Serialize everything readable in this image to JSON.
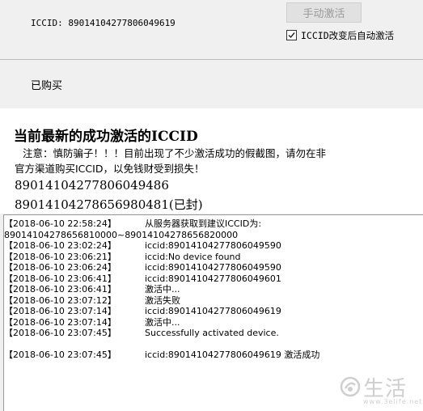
{
  "top": {
    "iccid_label": "ICCID: 89014104277806049619",
    "manual_activate_button": "手动激活",
    "auto_activate_label": "ICCID改变后自动激活",
    "auto_activate_checked": true
  },
  "purchased": {
    "label": "已购买"
  },
  "info": {
    "title": "当前最新的成功激活的ICCID",
    "warning_line_1": "注意：慎防骗子！！！目前出现了不少激活成功的假截图，请勿在非",
    "warning_line_2": "官方渠道购买ICCID，以免钱财受到损失！",
    "iccid_current": "89014104277806049486",
    "iccid_sealed": "89014104278656980481(已封)"
  },
  "log": {
    "rows": [
      {
        "time": "【2018-06-10 22:58:24】",
        "msg": "从服务器获取到建议ICCID为:"
      },
      {
        "time": "89014104278656810000~89014104278656820000",
        "msg": ""
      },
      {
        "time": "【2018-06-10 23:02:24】",
        "msg": "iccid:89014104277806049590"
      },
      {
        "time": "【2018-06-10 23:06:21】",
        "msg": "iccid:No device found"
      },
      {
        "time": "【2018-06-10 23:06:24】",
        "msg": "iccid:89014104277806049590"
      },
      {
        "time": "【2018-06-10 23:06:41】",
        "msg": "iccid:89014104277806049601"
      },
      {
        "time": "【2018-06-10 23:06:41】",
        "msg": "激活中..."
      },
      {
        "time": "【2018-06-10 23:07:12】",
        "msg": "激活失败"
      },
      {
        "time": "【2018-06-10 23:07:14】",
        "msg": "iccid:89014104277806049619"
      },
      {
        "time": "【2018-06-10 23:07:14】",
        "msg": "激活中..."
      },
      {
        "time": "【2018-06-10 23:07:45】",
        "msg": "Successfully activated device."
      },
      {
        "time": "",
        "msg": ""
      },
      {
        "time": "【2018-06-10 23:07:45】",
        "msg": "iccid:89014104277806049619 激活成功"
      }
    ]
  },
  "watermark": {
    "text": "生活",
    "url": "www.3elife.net"
  }
}
